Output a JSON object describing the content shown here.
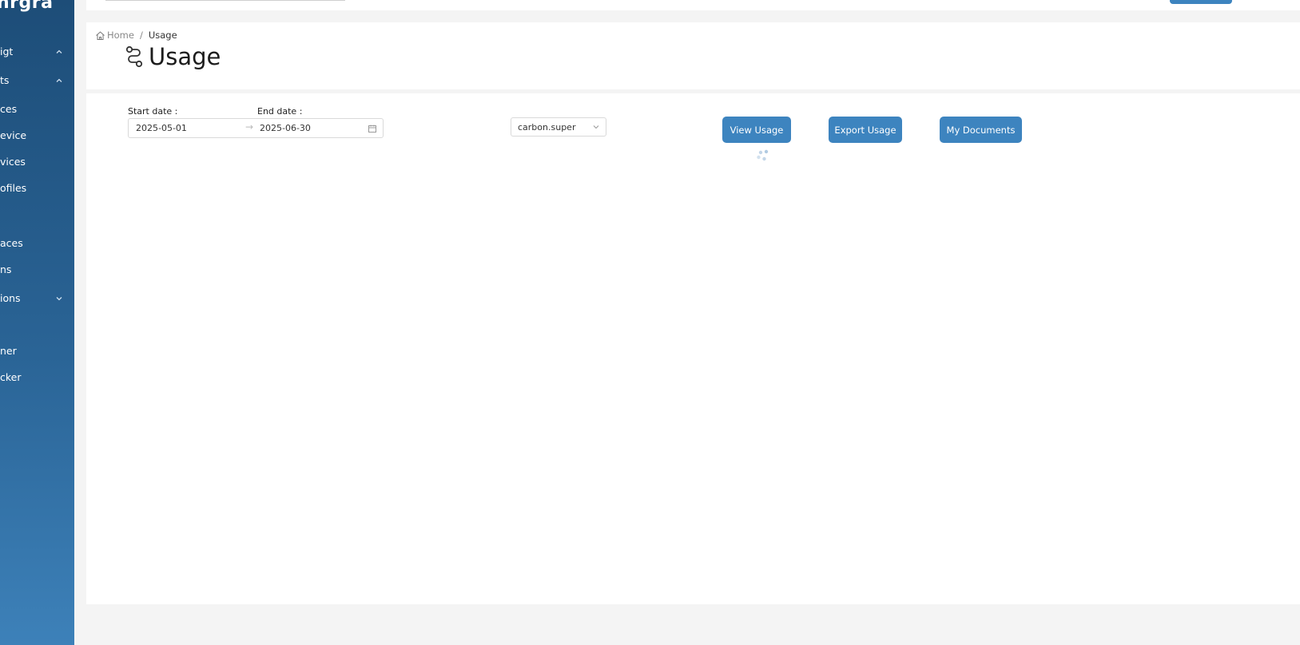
{
  "sidebar": {
    "brand": "nrgra",
    "items": [
      {
        "label": "igt",
        "chevron": "up"
      },
      {
        "label": "ts",
        "chevron": "up"
      },
      {
        "label": "ces"
      },
      {
        "label": "evice"
      },
      {
        "label": "vices"
      },
      {
        "label": "ofiles"
      },
      {
        "label": "aces"
      },
      {
        "label": "ns"
      },
      {
        "label": "ions",
        "chevron": "down"
      },
      {
        "label": "ner"
      },
      {
        "label": "cker"
      }
    ]
  },
  "breadcrumb": {
    "home": "Home",
    "separator": "/",
    "current": "Usage"
  },
  "page": {
    "title": "Usage"
  },
  "filters": {
    "start_label": "Start date :",
    "end_label": "End date :",
    "start_value": "2025-05-01",
    "end_value": "2025-06-30",
    "arrow": "→",
    "tenant_value": "carbon.super"
  },
  "actions": {
    "view_usage": "View Usage",
    "export_usage": "Export Usage",
    "my_documents": "My Documents"
  },
  "colors": {
    "primary": "#3d84bf",
    "sidebar_top": "#1d4d78",
    "sidebar_bottom": "#3d81b9",
    "page_bg": "#f4f4f4"
  }
}
